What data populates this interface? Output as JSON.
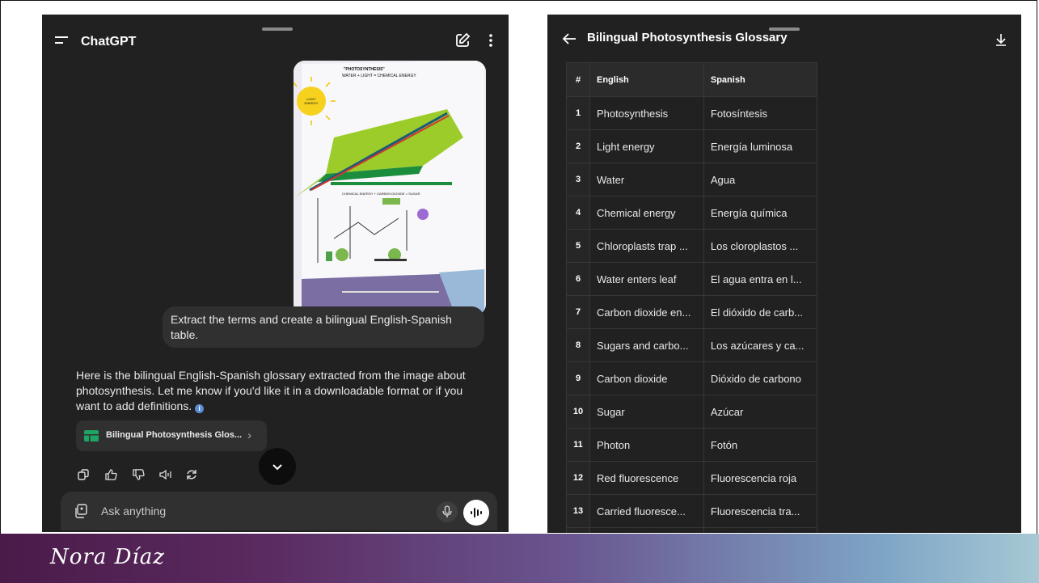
{
  "chat": {
    "app_title": "ChatGPT",
    "user_message": "Extract the terms and create a bilingual English-Spanish table.",
    "assistant_message": "Here is the bilingual English-Spanish glossary extracted from the image about photosynthesis. Let me know if you'd like it in a downloadable format or if you want to add definitions.",
    "info_icon": "i",
    "attachment_card_label": "Bilingual Photosynthesis Glos...",
    "chevron": "›",
    "composer_placeholder": "Ask anything",
    "uploaded_image": {
      "title": "\"PHOTOSYNTHESIS\"",
      "line1": "WATER + LIGHT = CHEMICAL ENERGY",
      "sun_label": "LIGHT ENERGY",
      "line2": "CHEMICAL ENERGY + CARBON DIOXIDE = SUGAR"
    }
  },
  "glossary": {
    "title": "Bilingual Photosynthesis Glossary",
    "columns": [
      "#",
      "English",
      "Spanish"
    ],
    "rows": [
      {
        "num": "1",
        "english": "Photosynthesis",
        "spanish": "Fotosíntesis"
      },
      {
        "num": "2",
        "english": "Light energy",
        "spanish": "Energía luminosa"
      },
      {
        "num": "3",
        "english": "Water",
        "spanish": "Agua"
      },
      {
        "num": "4",
        "english": "Chemical energy",
        "spanish": "Energía química"
      },
      {
        "num": "5",
        "english": "Chloroplasts trap ...",
        "spanish": "Los cloroplastos ..."
      },
      {
        "num": "6",
        "english": "Water enters leaf",
        "spanish": "El agua entra en l..."
      },
      {
        "num": "7",
        "english": "Carbon dioxide en...",
        "spanish": "El dióxido de carb..."
      },
      {
        "num": "8",
        "english": "Sugars and carbo...",
        "spanish": "Los azúcares y ca..."
      },
      {
        "num": "9",
        "english": "Carbon dioxide",
        "spanish": "Dióxido de carbono"
      },
      {
        "num": "10",
        "english": "Sugar",
        "spanish": "Azúcar"
      },
      {
        "num": "11",
        "english": "Photon",
        "spanish": "Fotón"
      },
      {
        "num": "12",
        "english": "Red fluorescence",
        "spanish": "Fluorescencia roja"
      },
      {
        "num": "13",
        "english": "Carried fluoresce...",
        "spanish": "Fluorescencia tra..."
      }
    ]
  },
  "footer": {
    "author": "Nora Díaz"
  },
  "icons": [
    "menu-icon",
    "new-chat-icon",
    "more-options-icon",
    "table-icon",
    "copy-icon",
    "thumbs-up-icon",
    "thumbs-down-icon",
    "read-aloud-icon",
    "regenerate-icon",
    "chevron-down-icon",
    "attach-icon",
    "mic-icon",
    "voice-mode-icon",
    "back-arrow-icon",
    "download-icon"
  ],
  "colors": {
    "app_background": "#212121",
    "bubble": "#303030",
    "accent_green": "#1fa463",
    "info_blue": "#5a8dd6"
  }
}
